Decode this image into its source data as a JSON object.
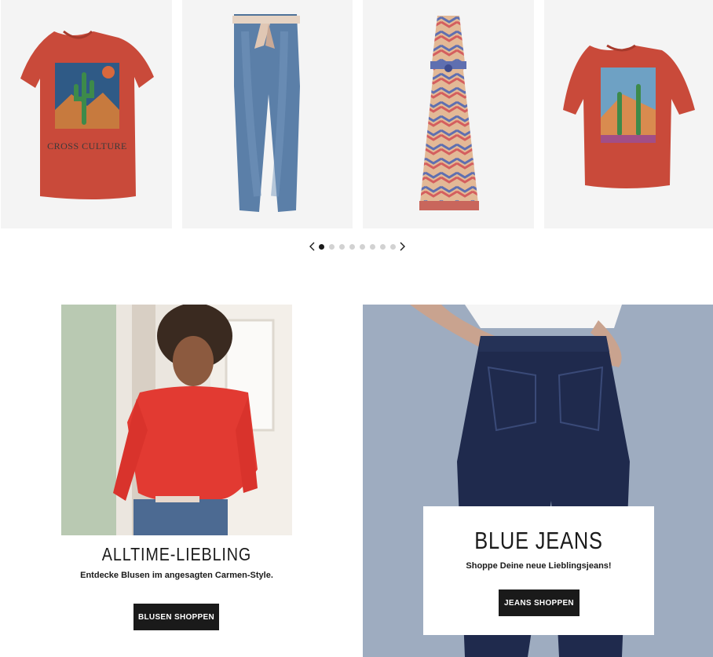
{
  "products": [
    {
      "name": "tshirt-cross-culture",
      "print_text": "CROSS CULTURE",
      "color": "#c94a3a"
    },
    {
      "name": "jeans-with-scarf-belt",
      "color": "#5b7fa8"
    },
    {
      "name": "maxi-dress-zigzag",
      "color": "#b86a6a"
    },
    {
      "name": "tshirt-desert-print",
      "color": "#c94a3a"
    }
  ],
  "carousel": {
    "dots": 8,
    "active_index": 0,
    "prev_icon": "chevron-left-icon",
    "next_icon": "chevron-right-icon"
  },
  "teaser_left": {
    "title": "ALLTIME-LIEBLING",
    "subtitle": "Entdecke Blusen im angesagten Carmen-Style.",
    "button_label": "BLUSEN SHOPPEN"
  },
  "teaser_right": {
    "title": "BLUE JEANS",
    "subtitle": "Shoppe Deine neue Lieblingsjeans!",
    "button_label": "JEANS SHOPPEN"
  },
  "colors": {
    "button_bg": "#1a1a1a",
    "tile_bg": "#f4f4f4",
    "jeans_bg": "#9eacc0"
  }
}
